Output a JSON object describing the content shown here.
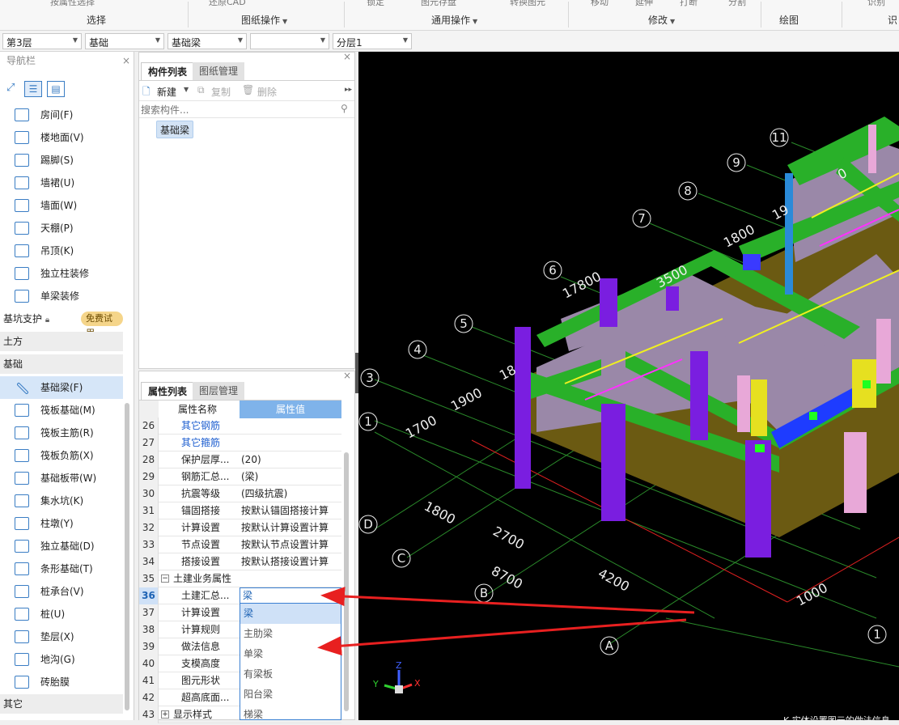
{
  "ribbon": {
    "cut_labels": [
      "按属性选择",
      "还原CAD",
      "锁定",
      "图元存盘",
      "转换图元",
      "移动",
      "延伸",
      "打断",
      "分割",
      "识别"
    ],
    "groups": [
      {
        "label": "选择",
        "has_caret": false
      },
      {
        "label": "图纸操作",
        "has_caret": true
      },
      {
        "label": "通用操作",
        "has_caret": true
      },
      {
        "label": "修改",
        "has_caret": true
      },
      {
        "label": "绘图",
        "has_caret": false
      },
      {
        "label": "识",
        "has_caret": false
      }
    ]
  },
  "toolbar": {
    "floor": "第3层",
    "category": "基础",
    "element_type": "基础梁",
    "element_name": "",
    "sublayer": "分层1"
  },
  "nav": {
    "title": "导航栏",
    "close": "×",
    "items_top": [
      {
        "label": "房间(F)",
        "icon": "room-icon"
      },
      {
        "label": "楼地面(V)",
        "icon": "floor-icon"
      },
      {
        "label": "踢脚(S)",
        "icon": "baseboard-icon"
      },
      {
        "label": "墙裙(U)",
        "icon": "dado-icon"
      },
      {
        "label": "墙面(W)",
        "icon": "wall-surface-icon"
      },
      {
        "label": "天棚(P)",
        "icon": "ceiling-icon"
      },
      {
        "label": "吊顶(K)",
        "icon": "suspended-ceiling-icon"
      },
      {
        "label": "独立柱装修",
        "icon": "column-finish-icon"
      },
      {
        "label": "单梁装修",
        "icon": "beam-finish-icon"
      }
    ],
    "cat_pit": "基坑支护",
    "free_trial": "免费试用",
    "cat_earth": "土方",
    "cat_foundation": "基础",
    "items_foundation": [
      {
        "label": "基础梁(F)",
        "icon": "foundation-beam-icon",
        "active": true
      },
      {
        "label": "筏板基础(M)",
        "icon": "raft-foundation-icon"
      },
      {
        "label": "筏板主筋(R)",
        "icon": "raft-main-rebar-icon"
      },
      {
        "label": "筏板负筋(X)",
        "icon": "raft-negative-rebar-icon"
      },
      {
        "label": "基础板带(W)",
        "icon": "foundation-strip-icon"
      },
      {
        "label": "集水坑(K)",
        "icon": "sump-icon"
      },
      {
        "label": "柱墩(Y)",
        "icon": "column-pier-icon"
      },
      {
        "label": "独立基础(D)",
        "icon": "isolated-footing-icon"
      },
      {
        "label": "条形基础(T)",
        "icon": "strip-footing-icon"
      },
      {
        "label": "桩承台(V)",
        "icon": "pile-cap-icon"
      },
      {
        "label": "桩(U)",
        "icon": "pile-icon"
      },
      {
        "label": "垫层(X)",
        "icon": "cushion-icon"
      },
      {
        "label": "地沟(G)",
        "icon": "trench-icon"
      },
      {
        "label": "砖胎膜",
        "icon": "brick-mold-icon"
      }
    ],
    "cat_other": "其它"
  },
  "complist": {
    "tab_active": "构件列表",
    "tab_inactive": "图纸管理",
    "new": "新建",
    "copy": "复制",
    "delete": "删除",
    "search_placeholder": "搜索构件...",
    "item": "基础梁",
    "close": "×"
  },
  "proplist": {
    "tab_active": "属性列表",
    "tab_inactive": "图层管理",
    "close": "×",
    "col_name": "属性名称",
    "col_value": "属性值",
    "rows": [
      {
        "num": "26",
        "name": "其它钢筋",
        "value": "",
        "style": "link"
      },
      {
        "num": "27",
        "name": "其它箍筋",
        "value": "",
        "style": "link"
      },
      {
        "num": "28",
        "name": "保护层厚...",
        "value": "(20)",
        "style": "normal"
      },
      {
        "num": "29",
        "name": "钢筋汇总...",
        "value": "(梁)",
        "style": "normal"
      },
      {
        "num": "30",
        "name": "抗震等级",
        "value": "(四级抗震)",
        "style": "normal"
      },
      {
        "num": "31",
        "name": "锚固搭接",
        "value": "按默认锚固搭接计算",
        "style": "normal"
      },
      {
        "num": "32",
        "name": "计算设置",
        "value": "按默认计算设置计算",
        "style": "normal"
      },
      {
        "num": "33",
        "name": "节点设置",
        "value": "按默认节点设置计算",
        "style": "normal"
      },
      {
        "num": "34",
        "name": "搭接设置",
        "value": "按默认搭接设置计算",
        "style": "normal"
      },
      {
        "num": "35",
        "name": "土建业务属性",
        "value": "",
        "style": "group",
        "toggle": "−"
      },
      {
        "num": "36",
        "name": "土建汇总...",
        "value": "梁",
        "style": "active"
      },
      {
        "num": "37",
        "name": "计算设置",
        "value": "",
        "style": "normal"
      },
      {
        "num": "38",
        "name": "计算规则",
        "value": "",
        "style": "normal"
      },
      {
        "num": "39",
        "name": "做法信息",
        "value": "",
        "style": "normal"
      },
      {
        "num": "40",
        "name": "支模高度",
        "value": "",
        "style": "normal"
      },
      {
        "num": "41",
        "name": "图元形状",
        "value": "",
        "style": "normal"
      },
      {
        "num": "42",
        "name": "超高底面...",
        "value": "",
        "style": "normal"
      },
      {
        "num": "43",
        "name": "显示样式",
        "value": "",
        "style": "group",
        "toggle": "+"
      }
    ]
  },
  "dropdown": {
    "options": [
      "梁",
      "主肋梁",
      "单梁",
      "有梁板",
      "阳台梁",
      "梯梁"
    ],
    "selected": "梁"
  },
  "viewport": {
    "axis_numbers": [
      "1",
      "3",
      "4",
      "5",
      "6",
      "7",
      "8",
      "9",
      "11"
    ],
    "axis_letters": [
      "A",
      "B",
      "C",
      "D"
    ],
    "axis_end": "1",
    "dims": [
      "1700",
      "1900",
      "17800",
      "3500",
      "1800",
      "1800",
      "2700",
      "8700",
      "4200",
      "1000",
      "18",
      "19",
      "0"
    ],
    "status_text": "K 实体设置图元的做法信息"
  },
  "colors": {
    "green_beam": "#29b029",
    "purple_column": "#7a1ee0",
    "slab": "#9a88a8",
    "pink": "#e8a8d8",
    "olive_wall": "#6b5a12",
    "axis_line": "#2a8a2a",
    "red_arrow": "#e82020",
    "accent_blue": "#3a80d2"
  }
}
